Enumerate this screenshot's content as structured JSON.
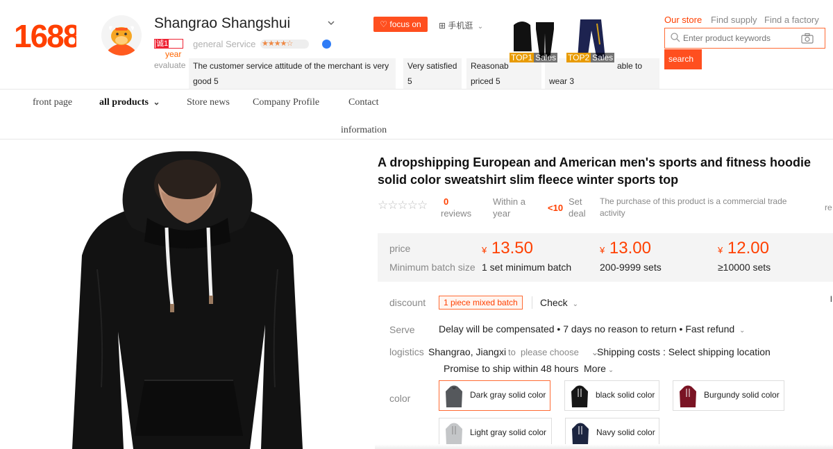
{
  "header": {
    "logo": "1688",
    "shop_name": "Shangrao Shangshui",
    "cheng_badge": "诚1",
    "year_text": "year",
    "service_label": "general Service",
    "service_stars": "★★★★☆",
    "focus_label": "focus on",
    "mobile_label": "手机逛",
    "evaluate_label": "evaluate",
    "evaluations": [
      {
        "text": "The customer service attitude of the merchant is very",
        "score": "good 5"
      },
      {
        "text": "Very satisfied",
        "score": "5"
      },
      {
        "text": "Reasonab",
        "score": "priced 5"
      },
      {
        "text": "able to",
        "score": "wear 3"
      }
    ],
    "top_items": [
      {
        "rank": "TOP1",
        "sales": "Sales"
      },
      {
        "rank": "TOP2",
        "sales": "Sales"
      }
    ],
    "store_links": [
      "Our store",
      "Find supply",
      "Find a factory"
    ],
    "search": {
      "placeholder": "Enter product keywords",
      "button": "search"
    }
  },
  "nav": {
    "items": [
      "front page",
      "all products",
      "Store news",
      "Company Profile",
      "Contact",
      "information"
    ]
  },
  "product": {
    "title_line1": "A dropshipping European and American men's sports and fitness hoodie",
    "title_line2": "solid color sweatshirt slim fleece winter sports top",
    "reviews_count": "0",
    "reviews_label": "reviews",
    "within_a": "Within a",
    "year": "year",
    "deal_count": "<10",
    "set": "Set",
    "deal": "deal",
    "trade_note_1": "The purchase of this product is a commercial trade",
    "trade_note_2": "activity",
    "edge_text": "re",
    "price_label": "price",
    "min_batch_label": "Minimum batch size",
    "currency": "¥",
    "tiers": [
      {
        "price": "13.50",
        "qty": "1 set minimum batch"
      },
      {
        "price": "13.00",
        "qty": "200-9999 sets"
      },
      {
        "price": "12.00",
        "qty": "≥10000 sets"
      }
    ],
    "discount_label": "discount",
    "discount_tag": "1 piece mixed batch",
    "check_label": "Check",
    "serve_label": "Serve",
    "serve_text": "Delay will be compensated • 7 days no reason to return • Fast refund",
    "logistics_label": "logistics",
    "origin": "Shangrao, Jiangxi",
    "to_label": "to",
    "dest_placeholder": "please choose",
    "shipping_text": "Shipping costs : Select shipping location",
    "promise_text": "Promise to ship within 48 hours",
    "more_label": "More",
    "color_label": "color",
    "colors": [
      {
        "name": "Dark gray solid color",
        "hex": "#55585c"
      },
      {
        "name": "black solid color",
        "hex": "#161616"
      },
      {
        "name": "Burgundy solid color",
        "hex": "#7a1424"
      },
      {
        "name": "Light gray solid color",
        "hex": "#c4c6c8"
      },
      {
        "name": "Navy solid color",
        "hex": "#1c2540"
      }
    ],
    "edge_mark": "l"
  },
  "colors": {
    "brand": "#ff4000",
    "accent": "#ff4f1f"
  }
}
